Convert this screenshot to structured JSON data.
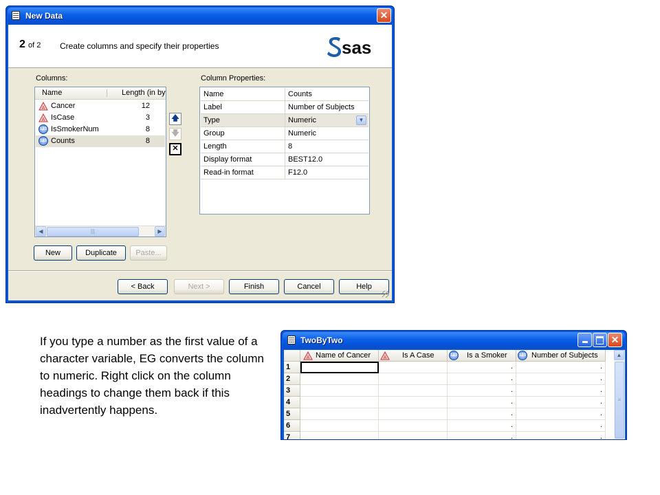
{
  "dialog": {
    "title": "New Data",
    "step_number": "2",
    "step_of": "of 2",
    "step_description": "Create columns and specify their properties",
    "brand": "sas",
    "columns_label": "Columns:",
    "columns_header": {
      "name": "Name",
      "length": "Length (in byt"
    },
    "columns": [
      {
        "name": "Cancer",
        "length": "12",
        "icon": "character-column-icon"
      },
      {
        "name": "IsCase",
        "length": "3",
        "icon": "character-column-icon"
      },
      {
        "name": "IsSmokerNum",
        "length": "8",
        "icon": "numeric-column-icon"
      },
      {
        "name": "Counts",
        "length": "8",
        "icon": "numeric-column-icon",
        "selected": true
      }
    ],
    "properties_label": "Column Properties:",
    "properties": [
      {
        "key": "Name",
        "value": "Counts"
      },
      {
        "key": "Label",
        "value": "Number of Subjects"
      },
      {
        "key": "Type",
        "value": "Numeric"
      },
      {
        "key": "Group",
        "value": "Numeric"
      },
      {
        "key": "Length",
        "value": "8"
      },
      {
        "key": "Display format",
        "value": "BEST12.0"
      },
      {
        "key": "Read-in format",
        "value": "F12.0"
      }
    ],
    "buttons": {
      "new": "New",
      "duplicate": "Duplicate",
      "paste": "Paste...",
      "back": "< Back",
      "next": "Next >",
      "finish": "Finish",
      "cancel": "Cancel",
      "help": "Help"
    }
  },
  "caption": "If you type a number as the first value of a character variable, EG converts the column to numeric. Right click on the column headings to change them back if this inadvertently happens.",
  "table_window": {
    "title": "TwoByTwo",
    "headers": [
      {
        "label": "Name of Cancer",
        "icon": "character-column-icon"
      },
      {
        "label": "Is A Case",
        "icon": "character-column-icon"
      },
      {
        "label": "Is a Smoker",
        "icon": "numeric-column-icon"
      },
      {
        "label": "Number of Subjects",
        "icon": "numeric-column-icon"
      }
    ],
    "rows": [
      {
        "n": "1",
        "c3": ".",
        "c4": "."
      },
      {
        "n": "2",
        "c3": ".",
        "c4": "."
      },
      {
        "n": "3",
        "c3": ".",
        "c4": "."
      },
      {
        "n": "4",
        "c3": ".",
        "c4": "."
      },
      {
        "n": "5",
        "c3": ".",
        "c4": "."
      },
      {
        "n": "6",
        "c3": ".",
        "c4": "."
      },
      {
        "n": "7",
        "c3": ".",
        "c4": "."
      }
    ]
  }
}
